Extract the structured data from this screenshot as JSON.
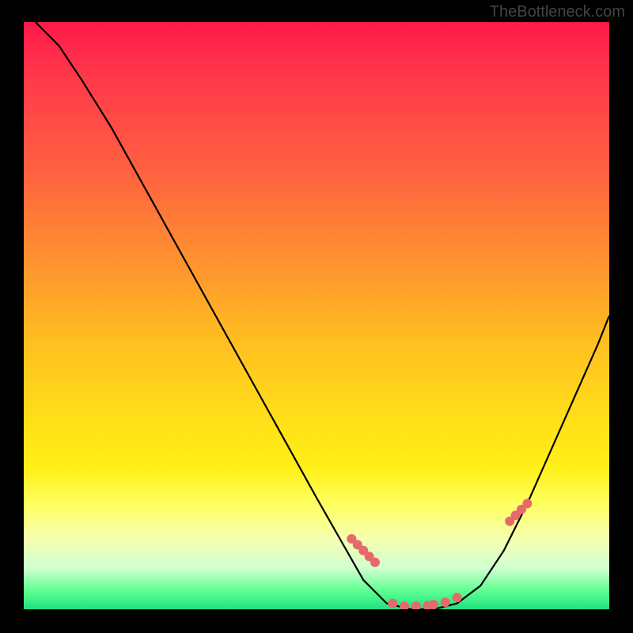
{
  "watermark": "TheBottleneck.com",
  "chart_data": {
    "type": "line",
    "title": "",
    "xlabel": "",
    "ylabel": "",
    "xlim": [
      0,
      100
    ],
    "ylim": [
      0,
      100
    ],
    "curve": {
      "name": "bottleneck-curve",
      "x": [
        2,
        6,
        10,
        15,
        20,
        25,
        30,
        35,
        40,
        45,
        50,
        54,
        58,
        62,
        66,
        70,
        74,
        78,
        82,
        86,
        90,
        94,
        98,
        100
      ],
      "y": [
        100,
        96,
        90,
        82,
        73,
        64,
        55,
        46,
        37,
        28,
        19,
        12,
        5,
        1,
        0,
        0,
        1,
        4,
        10,
        18,
        27,
        36,
        45,
        50
      ]
    },
    "markers": {
      "name": "highlight-points",
      "color": "#e76a6a",
      "x": [
        56,
        57,
        58,
        59,
        60,
        63,
        65,
        67,
        69,
        70,
        72,
        74,
        83,
        84,
        85,
        86
      ],
      "y": [
        12,
        11,
        10,
        9,
        8,
        1,
        0.5,
        0.5,
        0.6,
        0.8,
        1.2,
        2,
        15,
        16,
        17,
        18
      ]
    }
  }
}
